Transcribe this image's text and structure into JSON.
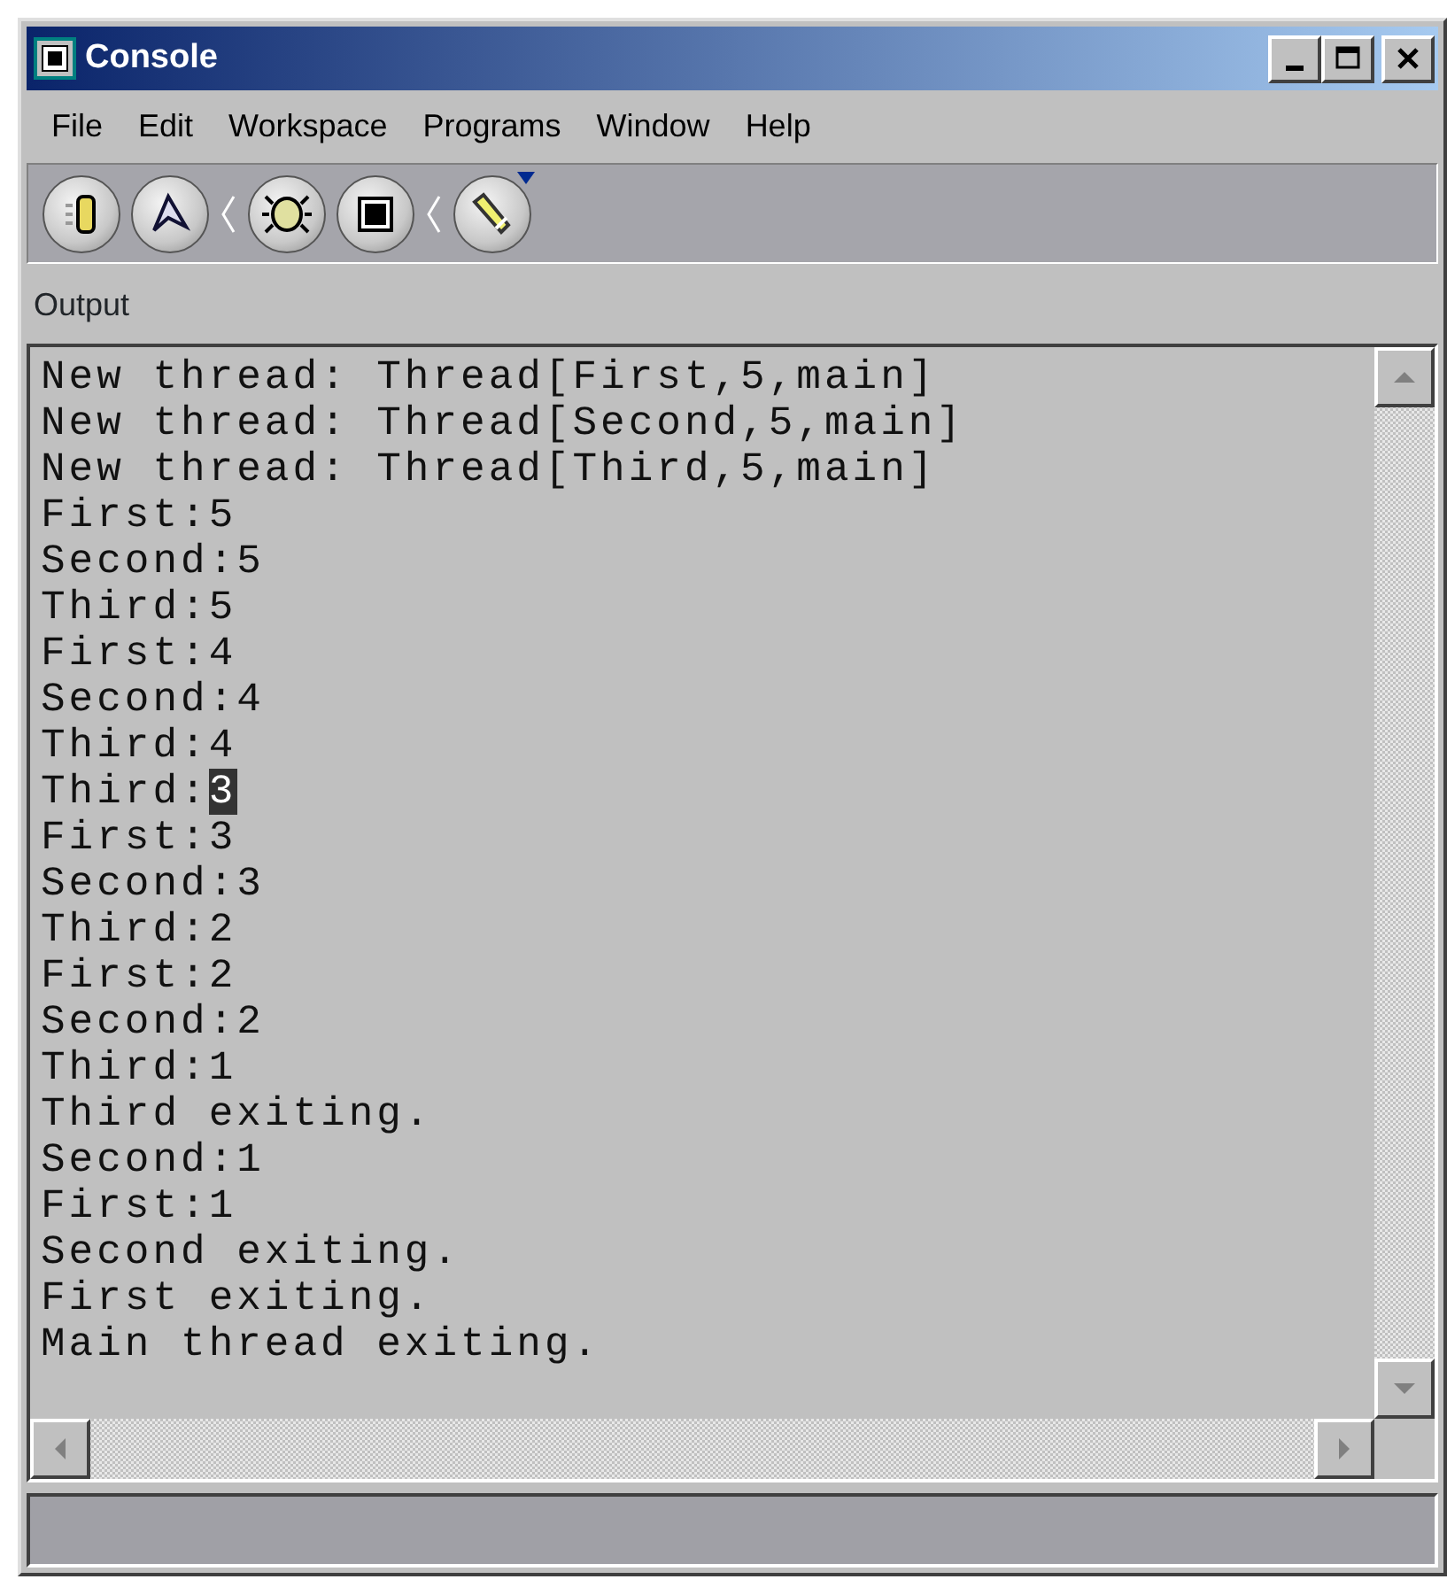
{
  "window": {
    "title": "Console"
  },
  "menu": [
    "File",
    "Edit",
    "Workspace",
    "Programs",
    "Window",
    "Help"
  ],
  "panel": {
    "title": "Output"
  },
  "output": [
    [
      {
        "text": "New thread: Thread[First,5,main]",
        "selected": false
      }
    ],
    [
      {
        "text": "New thread: Thread[Second,5,main]",
        "selected": false
      }
    ],
    [
      {
        "text": "New thread: Thread[Third,5,main]",
        "selected": false
      }
    ],
    [
      {
        "text": "First:5",
        "selected": false
      }
    ],
    [
      {
        "text": "Second:5",
        "selected": false
      }
    ],
    [
      {
        "text": "Third:5",
        "selected": false
      }
    ],
    [
      {
        "text": "First:4",
        "selected": false
      }
    ],
    [
      {
        "text": "Second:4",
        "selected": false
      }
    ],
    [
      {
        "text": "Third:4",
        "selected": false
      }
    ],
    [
      {
        "text": "Third:",
        "selected": false
      },
      {
        "text": "3",
        "selected": true
      }
    ],
    [
      {
        "text": "First:3",
        "selected": false
      }
    ],
    [
      {
        "text": "Second:3",
        "selected": false
      }
    ],
    [
      {
        "text": "Third:2",
        "selected": false
      }
    ],
    [
      {
        "text": "First:2",
        "selected": false
      }
    ],
    [
      {
        "text": "Second:2",
        "selected": false
      }
    ],
    [
      {
        "text": "Third:1",
        "selected": false
      }
    ],
    [
      {
        "text": "Third exiting.",
        "selected": false
      }
    ],
    [
      {
        "text": "Second:1",
        "selected": false
      }
    ],
    [
      {
        "text": "First:1",
        "selected": false
      }
    ],
    [
      {
        "text": "Second exiting.",
        "selected": false
      }
    ],
    [
      {
        "text": "First exiting.",
        "selected": false
      }
    ],
    [
      {
        "text": "Main thread exiting.",
        "selected": false
      }
    ]
  ]
}
